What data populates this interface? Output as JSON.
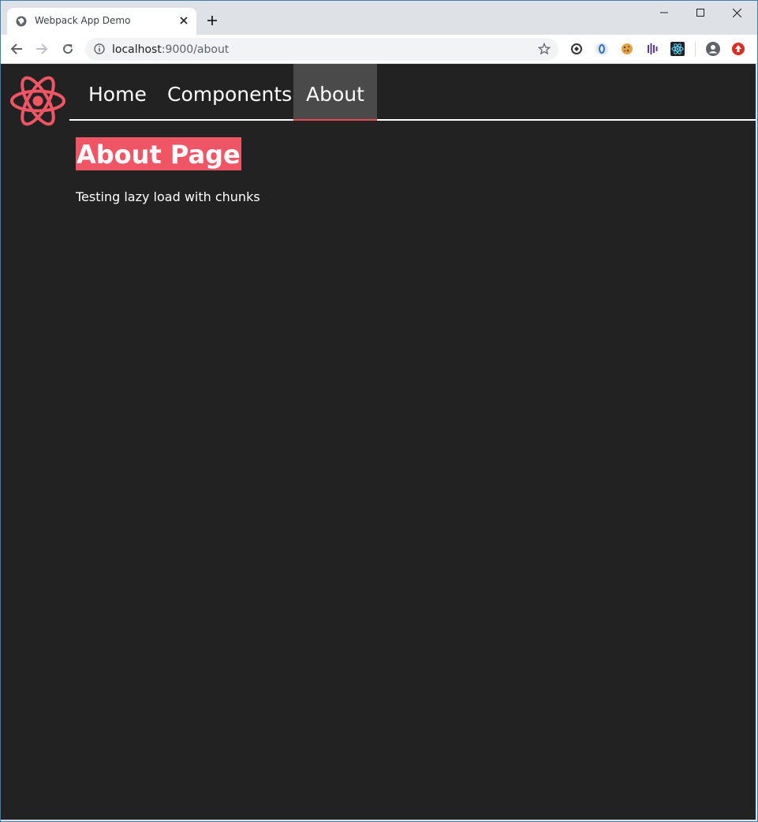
{
  "browser": {
    "tab_title": "Webpack App Demo",
    "url_host": "localhost",
    "url_path": ":9000/about"
  },
  "nav": {
    "items": [
      {
        "label": "Home"
      },
      {
        "label": "Components"
      },
      {
        "label": "About"
      }
    ],
    "active": "About"
  },
  "page": {
    "heading": "About Page",
    "text": "Testing lazy load with chunks"
  },
  "colors": {
    "page_bg": "#222222",
    "accent": "#f05565",
    "active_tab_bg": "#4a4a4a"
  }
}
